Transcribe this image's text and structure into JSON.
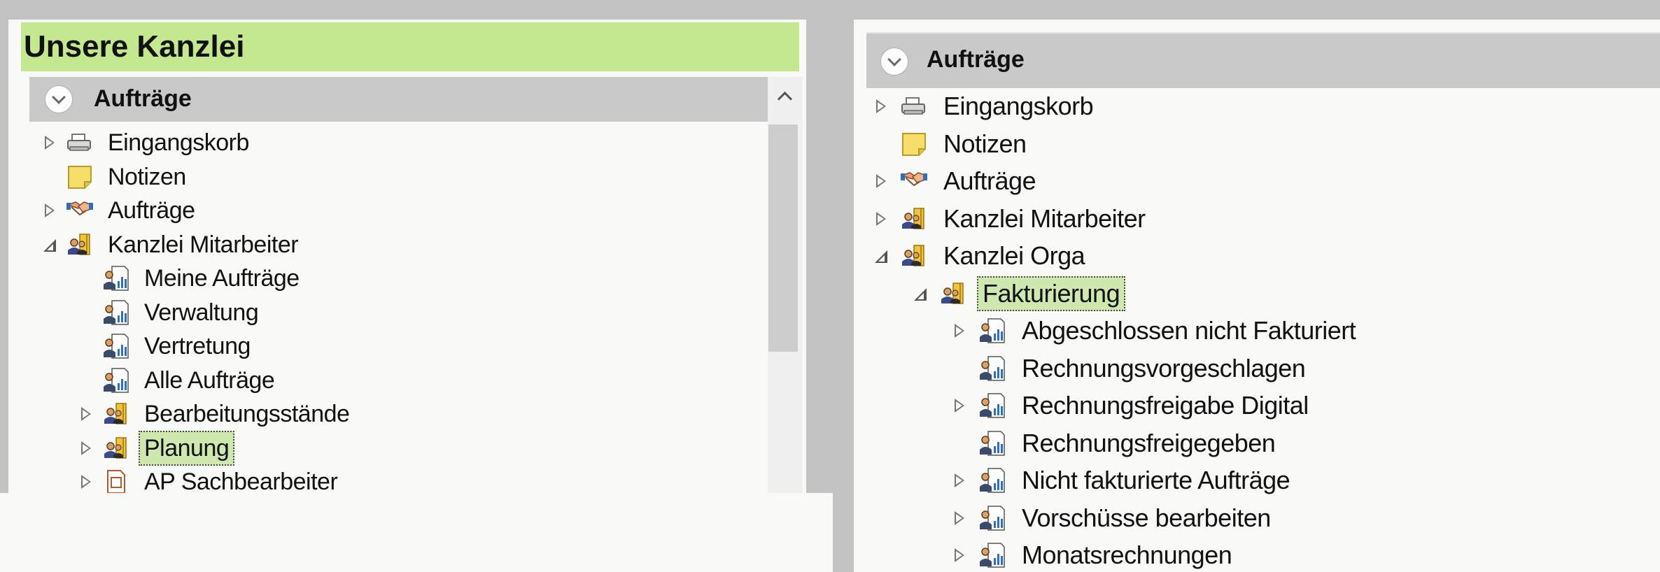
{
  "left": {
    "title": "Unsere Kanzlei",
    "section": {
      "label": "Aufträge",
      "icon": "chevron-down-icon"
    },
    "tree": [
      {
        "label": "Eingangskorb",
        "icon": "printer-icon",
        "expander": "collapsed",
        "level": 0
      },
      {
        "label": "Notizen",
        "icon": "note-icon",
        "expander": "none",
        "level": 0
      },
      {
        "label": "Aufträge",
        "icon": "handshake-icon",
        "expander": "collapsed",
        "level": 0
      },
      {
        "label": "Kanzlei Mitarbeiter",
        "icon": "people-folder-icon",
        "expander": "expanded",
        "level": 0
      },
      {
        "label": "Meine Aufträge",
        "icon": "person-report-icon",
        "expander": "none",
        "level": 1
      },
      {
        "label": "Verwaltung",
        "icon": "person-report-icon",
        "expander": "none",
        "level": 1
      },
      {
        "label": "Vertretung",
        "icon": "person-report-icon",
        "expander": "none",
        "level": 1
      },
      {
        "label": "Alle Aufträge",
        "icon": "person-report-icon",
        "expander": "none",
        "level": 1
      },
      {
        "label": "Bearbeitungsstände",
        "icon": "people-folder-icon",
        "expander": "collapsed",
        "level": 1
      },
      {
        "label": "Planung",
        "icon": "people-folder-icon",
        "expander": "collapsed",
        "level": 1,
        "selected": true
      },
      {
        "label": "AP Sachbearbeiter",
        "icon": "document-icon",
        "expander": "collapsed",
        "level": 1
      }
    ]
  },
  "right": {
    "section": {
      "label": "Aufträge",
      "icon": "chevron-down-icon"
    },
    "tree": [
      {
        "label": "Eingangskorb",
        "icon": "printer-icon",
        "expander": "collapsed",
        "level": 0
      },
      {
        "label": "Notizen",
        "icon": "note-icon",
        "expander": "none",
        "level": 0
      },
      {
        "label": "Aufträge",
        "icon": "handshake-icon",
        "expander": "collapsed",
        "level": 0
      },
      {
        "label": "Kanzlei Mitarbeiter",
        "icon": "people-folder-icon",
        "expander": "collapsed",
        "level": 0
      },
      {
        "label": "Kanzlei Orga",
        "icon": "people-folder-icon",
        "expander": "expanded",
        "level": 0
      },
      {
        "label": "Fakturierung",
        "icon": "people-folder-icon",
        "expander": "expanded",
        "level": 1,
        "selected": true
      },
      {
        "label": "Abgeschlossen nicht Fakturiert",
        "icon": "person-report-icon",
        "expander": "collapsed",
        "level": 2
      },
      {
        "label": "Rechnungsvorgeschlagen",
        "icon": "person-report-icon",
        "expander": "none",
        "level": 2
      },
      {
        "label": "Rechnungsfreigabe Digital",
        "icon": "person-report-icon",
        "expander": "collapsed",
        "level": 2
      },
      {
        "label": "Rechnungsfreigegeben",
        "icon": "person-report-icon",
        "expander": "none",
        "level": 2
      },
      {
        "label": "Nicht fakturierte Aufträge",
        "icon": "person-report-icon",
        "expander": "collapsed",
        "level": 2
      },
      {
        "label": "Vorschüsse bearbeiten",
        "icon": "person-report-icon",
        "expander": "collapsed",
        "level": 2
      },
      {
        "label": "Monatsrechnungen",
        "icon": "person-report-icon",
        "expander": "collapsed",
        "level": 2
      }
    ]
  },
  "colors": {
    "title_bar": "#c4e890",
    "section_header": "#c9c9c9",
    "selection": "#cfe8b0",
    "background": "#c3c3c3"
  }
}
